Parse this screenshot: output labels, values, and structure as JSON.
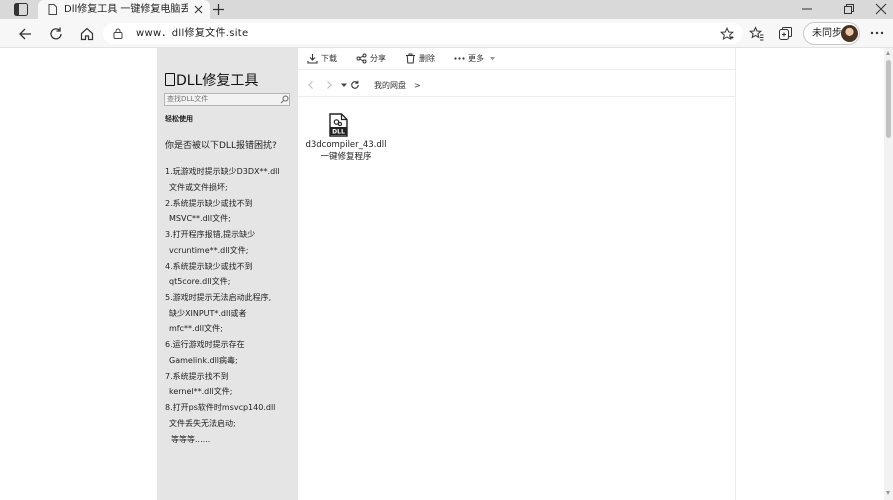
{
  "browser": {
    "tab": {
      "title": "Dll修复工具 一键修复电脑丢失D",
      "favicon": "page-icon"
    },
    "address": {
      "url": "www．dll修复文件.site",
      "lock_icon": "lock-icon"
    },
    "profile": {
      "sync_label": "未同步"
    },
    "icons": [
      "tab-actions-icon",
      "close-icon",
      "new-tab-icon",
      "minimize-icon",
      "restore-icon",
      "window-close-icon",
      "back-icon",
      "refresh-icon",
      "home-icon",
      "favorite-star-icon",
      "favorites-icon",
      "collections-icon",
      "more-icon"
    ]
  },
  "sidebar": {
    "logo": "DLL修复工具",
    "search_placeholder": "查找DLL文件",
    "easy_use": "轻松使用",
    "question": "你是否被以下DLL报错困扰?",
    "lines": [
      "1.玩游戏时提示缺少D3DX**.dll",
      "文件或文件损坏;",
      "2.系统提示缺少或找不到",
      "MSVC**.dll文件;",
      "3.打开程序报错,提示缺少",
      "vcruntime**.dll文件;",
      "4.系统提示缺少或找不到",
      "qt5core.dll文件;",
      "5.游戏时提示无法启动此程序,",
      "缺少XINPUT*.dll或者",
      "mfc**.dll文件;",
      "6.运行游戏时提示存在",
      "Gamelink.dll病毒;",
      "7.系统提示找不到",
      "kernel**.dll文件;",
      "8.打开ps软件时msvcp140.dll",
      "文件丢失无法启动;",
      "等等等......"
    ]
  },
  "main": {
    "toolbar": {
      "download": "下载",
      "share": "分享",
      "delete": "删除",
      "more": "更多"
    },
    "breadcrumb": "我的网盘　>",
    "file": {
      "name": "d3dcompiler_43.dll",
      "subtitle": "一键修复程序",
      "icon_label": "DLL"
    }
  },
  "colors": {
    "tabstrip": "#d9d9d9",
    "toolbar": "#f7f7f7",
    "sidebar": "#e5e5e5",
    "page": "#ffffff"
  }
}
